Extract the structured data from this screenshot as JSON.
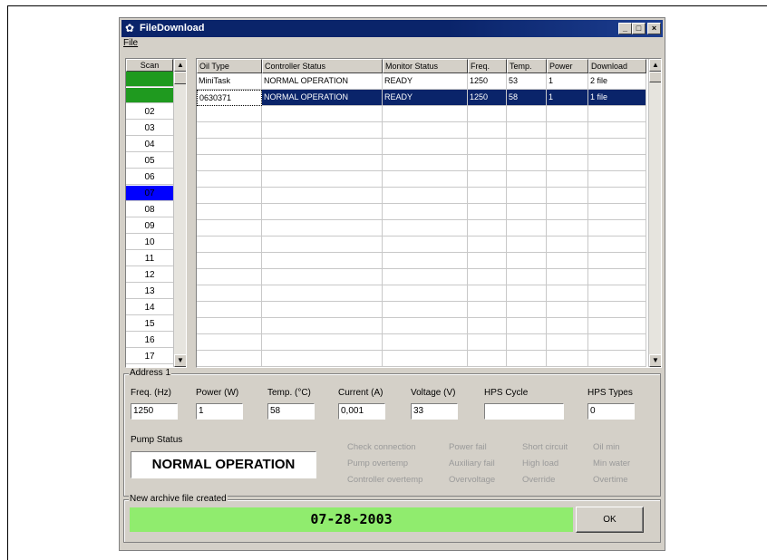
{
  "window": {
    "title": "FileDownload",
    "icon": "app-icon",
    "controls": [
      "minimize",
      "maximize",
      "close"
    ]
  },
  "menu": {
    "file": "File"
  },
  "scan": {
    "header": "Scan",
    "rows": [
      {
        "label": "",
        "color": "#1f9a1f"
      },
      {
        "label": "",
        "color": "#1f9a1f"
      },
      {
        "label": "02",
        "color": ""
      },
      {
        "label": "03",
        "color": ""
      },
      {
        "label": "04",
        "color": ""
      },
      {
        "label": "05",
        "color": ""
      },
      {
        "label": "06",
        "color": ""
      },
      {
        "label": "07",
        "color": "#0000ff"
      },
      {
        "label": "08",
        "color": ""
      },
      {
        "label": "09",
        "color": ""
      },
      {
        "label": "10",
        "color": ""
      },
      {
        "label": "11",
        "color": ""
      },
      {
        "label": "12",
        "color": ""
      },
      {
        "label": "13",
        "color": ""
      },
      {
        "label": "14",
        "color": ""
      },
      {
        "label": "15",
        "color": ""
      },
      {
        "label": "16",
        "color": ""
      },
      {
        "label": "17",
        "color": ""
      }
    ]
  },
  "table": {
    "columns": [
      "Oil Type",
      "Controller Status",
      "Monitor Status",
      "Freq.",
      "Temp.",
      "Power",
      "Download"
    ],
    "rows": [
      [
        "MiniTask",
        "NORMAL OPERATION",
        "READY",
        "1250",
        "53",
        "1",
        "2 file"
      ],
      [
        "0630371",
        "NORMAL OPERATION",
        "READY",
        "1250",
        "58",
        "1",
        "1 file"
      ]
    ],
    "selected_row": 1
  },
  "address": {
    "label": "Address 1",
    "fields": [
      {
        "label": "Freq. (Hz)",
        "value": "1250"
      },
      {
        "label": "Power (W)",
        "value": "1"
      },
      {
        "label": "Temp. (°C)",
        "value": "58"
      },
      {
        "label": "Current (A)",
        "value": "0,001"
      },
      {
        "label": "Voltage (V)",
        "value": "33"
      },
      {
        "label": "HPS Cycle",
        "value": ""
      },
      {
        "label": "HPS Types",
        "value": "0"
      }
    ]
  },
  "pump": {
    "label": "Pump Status",
    "value": "NORMAL OPERATION",
    "flags": [
      [
        "Check connection",
        "Power fail",
        "Short circuit",
        "Oil min"
      ],
      [
        "Pump overtemp",
        "Auxiliary fail",
        "High load",
        "Min water"
      ],
      [
        "Controller overtemp",
        "Overvoltage",
        "Override",
        "Overtime"
      ]
    ]
  },
  "archive": {
    "label": "New archive file created",
    "date": "07-28-2003",
    "ok": "OK"
  }
}
